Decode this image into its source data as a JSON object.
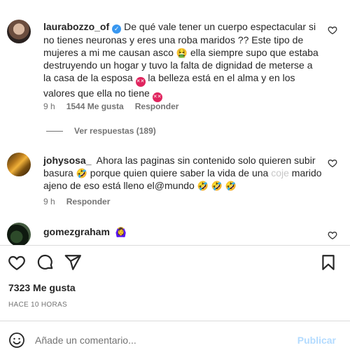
{
  "comments": [
    {
      "username": "laurabozzo_of",
      "text_1": "De qué vale tener un cuerpo espectacular si no tienes neuronas y eres una roba maridos ?? Este tipo de mujeres a mi me causan asco",
      "text_2": "ella siempre supo que estaba destruyendo un hogar y tuvo la falta de dignidad de meterse a la casa de la esposa",
      "text_3": "la belleza está en el alma y en los valores que ella no tiene",
      "time": "9 h",
      "likes": "1544 Me gusta",
      "reply": "Responder",
      "view_replies": "Ver respuestas (189)"
    },
    {
      "username": "johysosa_",
      "text_1": "Ahora las paginas sin contenido solo quieren subir basura",
      "text_2": "porque quien quiere saber la vida de una",
      "text_faded": "coje",
      "text_3": "marido ajeno de eso está lleno el@mundo",
      "time": "9 h",
      "reply": "Responder"
    },
    {
      "username": "gomezgraham"
    }
  ],
  "post": {
    "likes": "7323 Me gusta",
    "time_ago": "HACE 10 HORAS"
  },
  "add_comment": {
    "placeholder": "Añade un comentario...",
    "publish": "Publicar"
  },
  "icons": {
    "verified": "verified-badge-icon",
    "like": "heart-icon",
    "comment": "comment-bubble-icon",
    "share": "paper-plane-icon",
    "save": "bookmark-icon",
    "emoji": "smiley-icon"
  },
  "colors": {
    "verified": "#3897f0",
    "publish_disabled": "#b3dbff",
    "meta_text": "#737373"
  }
}
